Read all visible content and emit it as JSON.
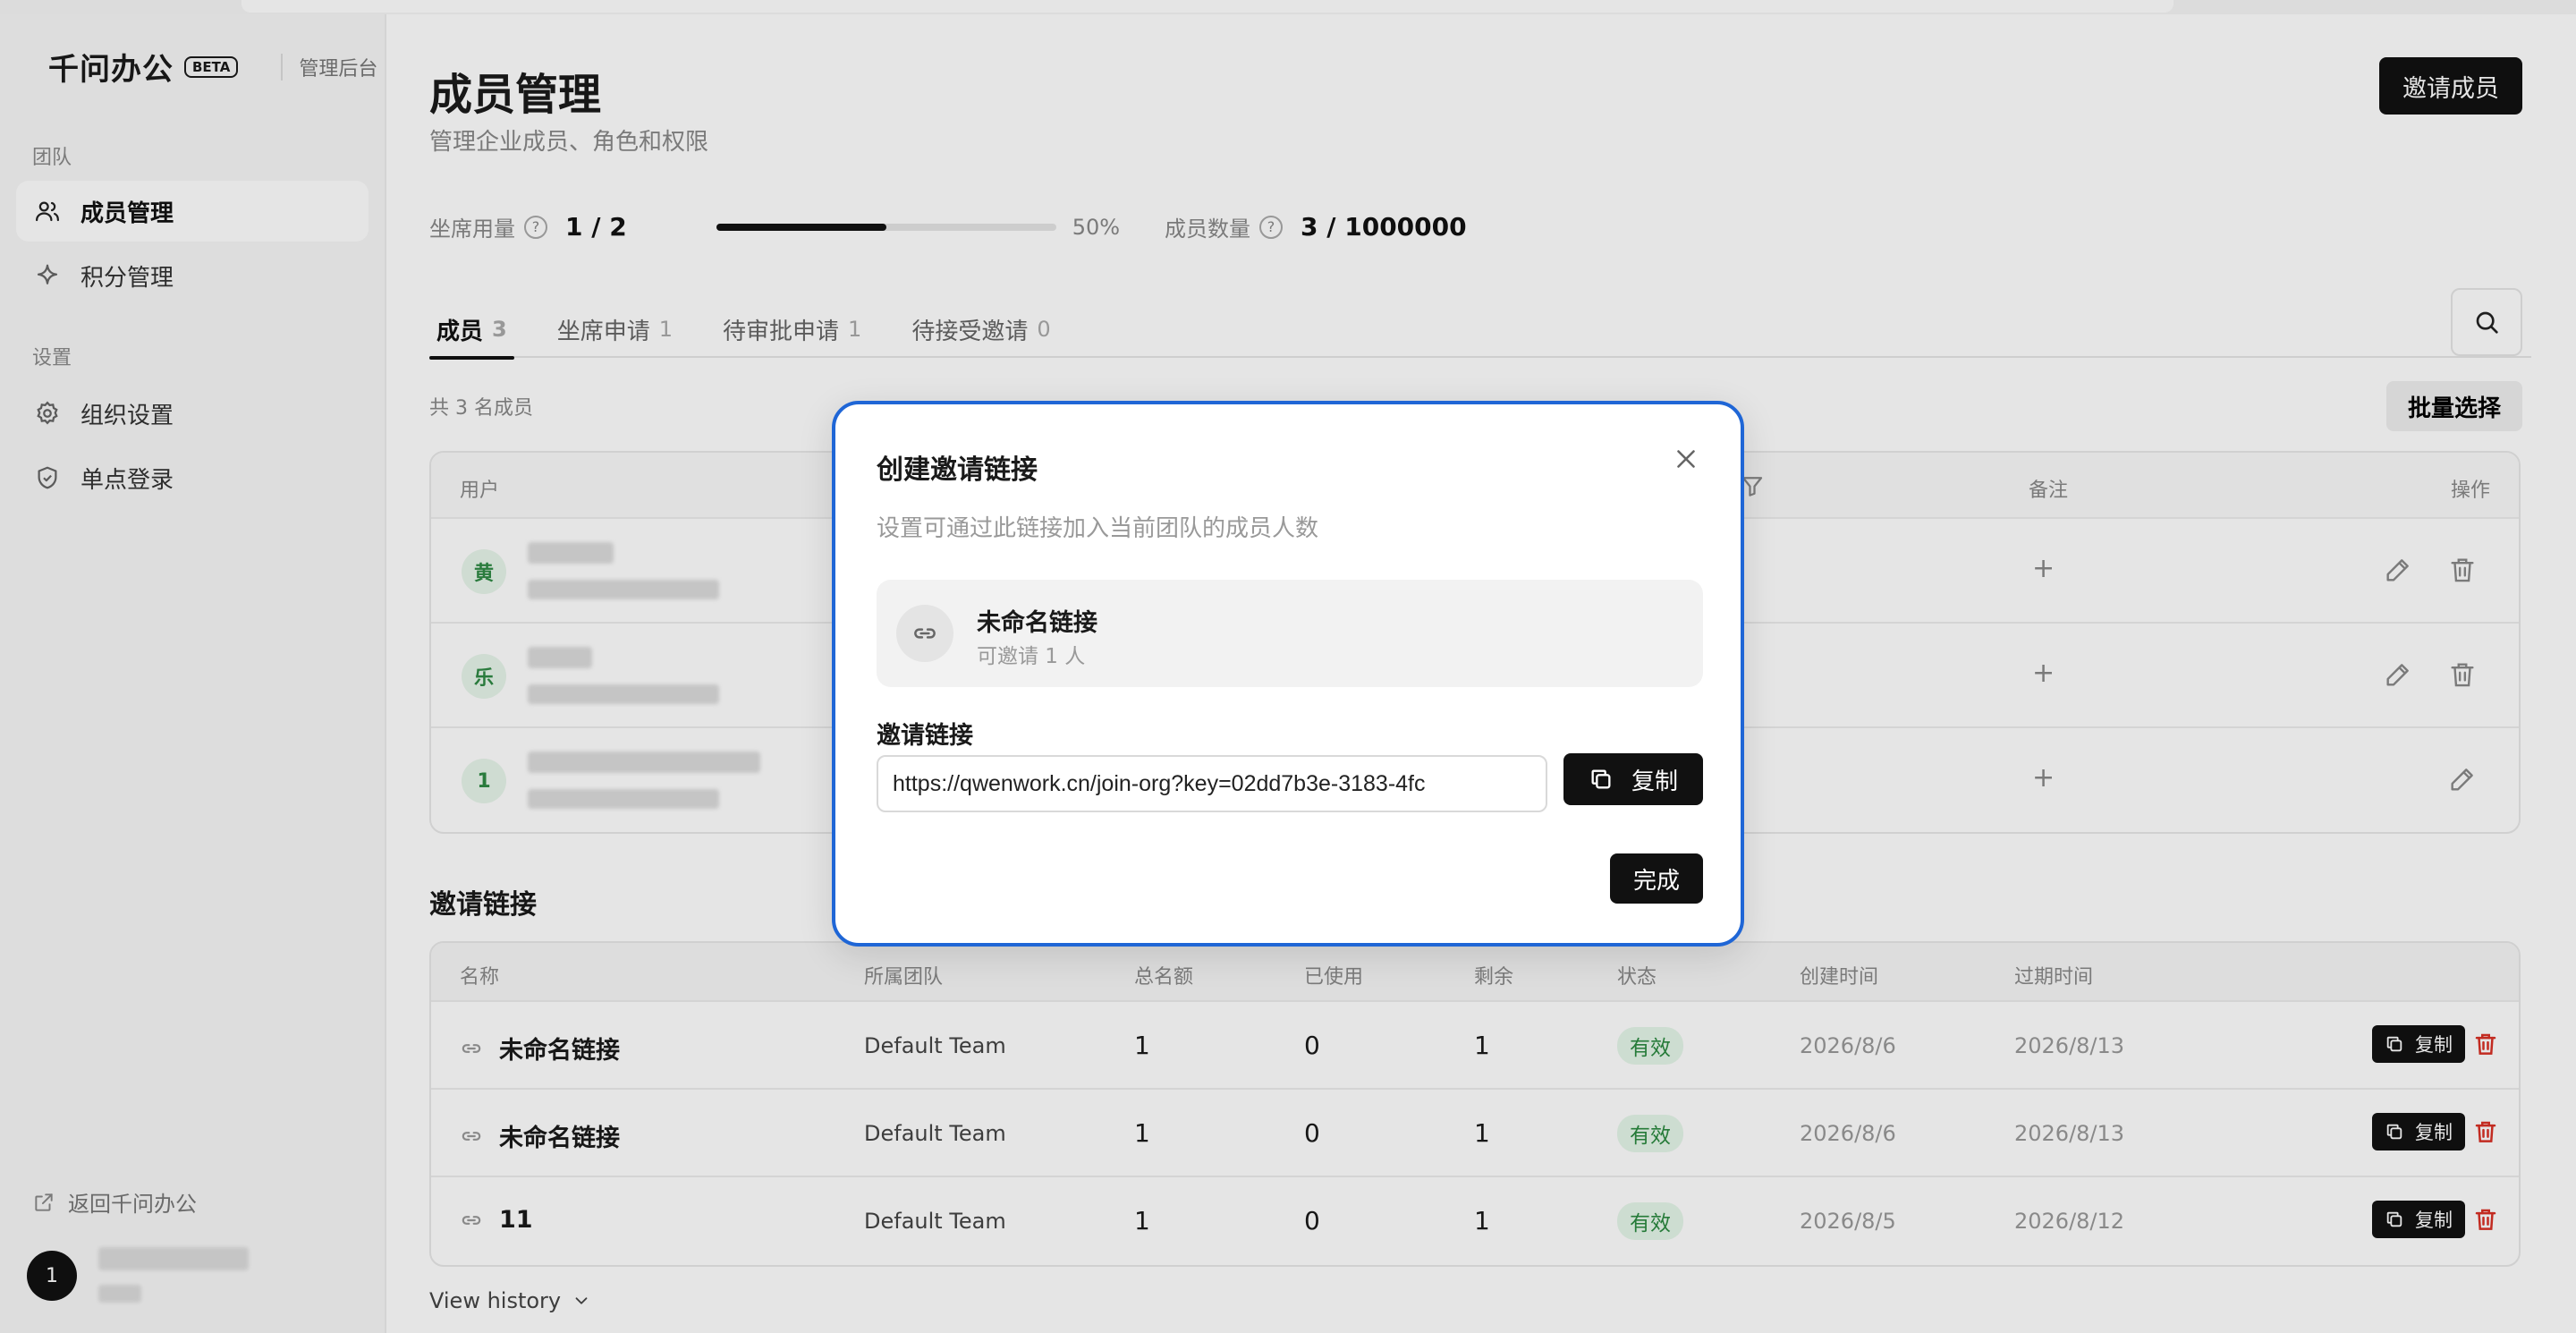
{
  "brand": {
    "name": "千问办公",
    "badge": "BETA",
    "subtitle": "管理后台"
  },
  "sidebar": {
    "section_team": "团队",
    "section_settings": "设置",
    "items": [
      {
        "label": "成员管理",
        "icon": "users-icon"
      },
      {
        "label": "积分管理",
        "icon": "sparkle-icon"
      },
      {
        "label": "组织设置",
        "icon": "gear-icon"
      },
      {
        "label": "单点登录",
        "icon": "shield-icon"
      }
    ],
    "back_label": "返回千问办公",
    "avatar_initial": "1"
  },
  "header": {
    "title": "成员管理",
    "subtitle": "管理企业成员、角色和权限",
    "invite_button": "邀请成员"
  },
  "stats": {
    "seat_label": "坐席用量",
    "seat_value": "1 / 2",
    "seat_percent_text": "50%",
    "seat_fraction": 0.5,
    "member_label": "成员数量",
    "member_value": "3 / 1000000",
    "help_glyph": "?"
  },
  "tabs": [
    {
      "label": "成员",
      "count": "3"
    },
    {
      "label": "坐席申请",
      "count": "1"
    },
    {
      "label": "待审批申请",
      "count": "1"
    },
    {
      "label": "待接受邀请",
      "count": "0"
    }
  ],
  "members": {
    "count_text": "共 3 名成员",
    "batch_button": "批量选择",
    "columns": {
      "user": "用户",
      "note": "备注",
      "actions": "操作"
    },
    "rows": [
      {
        "initial": "黄",
        "note_add": "+"
      },
      {
        "initial": "乐",
        "note_add": "+"
      },
      {
        "initial": "1",
        "note_add": "+"
      }
    ]
  },
  "invite_links": {
    "title": "邀请链接",
    "columns": {
      "name": "名称",
      "team": "所属团队",
      "quota": "总名额",
      "used": "已使用",
      "remaining": "剩余",
      "status": "状态",
      "created": "创建时间",
      "expires": "过期时间"
    },
    "copy_label": "复制",
    "rows": [
      {
        "name": "未命名链接",
        "team": "Default Team",
        "quota": "1",
        "used": "0",
        "remaining": "1",
        "status": "有效",
        "created": "2026/8/6",
        "expires": "2026/8/13"
      },
      {
        "name": "未命名链接",
        "team": "Default Team",
        "quota": "1",
        "used": "0",
        "remaining": "1",
        "status": "有效",
        "created": "2026/8/6",
        "expires": "2026/8/13"
      },
      {
        "name": "11",
        "team": "Default Team",
        "quota": "1",
        "used": "0",
        "remaining": "1",
        "status": "有效",
        "created": "2026/8/5",
        "expires": "2026/8/12"
      }
    ],
    "view_history": "View history"
  },
  "modal": {
    "title": "创建邀请链接",
    "subtitle": "设置可通过此链接加入当前团队的成员人数",
    "link_name": "未命名链接",
    "link_capacity": "可邀请 1 人",
    "field_label": "邀请链接",
    "url": "https://qwenwork.cn/join-org?key=02dd7b3e-3183-4fc",
    "copy_button": "复制",
    "done_button": "完成"
  },
  "colors": {
    "accent": "#1f66d6",
    "primary": "#111111",
    "success": "#2b8a40",
    "danger": "#d93025"
  }
}
